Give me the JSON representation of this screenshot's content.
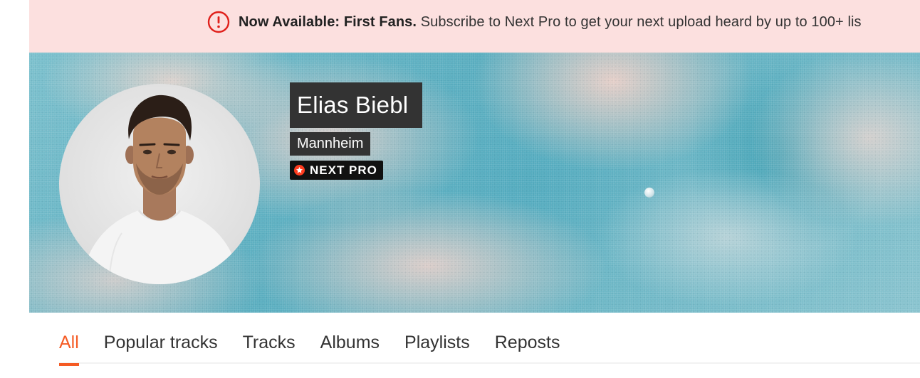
{
  "banner": {
    "icon": "alert-circle-icon",
    "bold_text": "Now Available: First Fans.",
    "text": " Subscribe to Next Pro to get your next upload heard by up to 100+ lis",
    "accent_color": "#e0201b"
  },
  "profile": {
    "name": "Elias Biebl",
    "city": "Mannheim",
    "badge": "NEXT PRO",
    "badge_color": "#ff3c1f"
  },
  "tabs": [
    {
      "label": "All",
      "active": true
    },
    {
      "label": "Popular tracks",
      "active": false
    },
    {
      "label": "Tracks",
      "active": false
    },
    {
      "label": "Albums",
      "active": false
    },
    {
      "label": "Playlists",
      "active": false
    },
    {
      "label": "Reposts",
      "active": false
    }
  ],
  "colors": {
    "accent": "#f55b24",
    "banner_bg": "#fce0df"
  }
}
